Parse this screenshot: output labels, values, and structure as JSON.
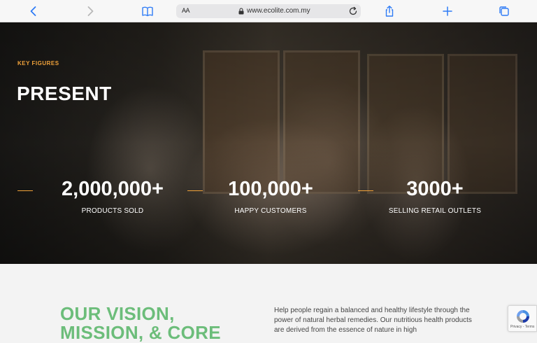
{
  "browser": {
    "text_size_label": "AA",
    "url": "www.ecolite.com.my"
  },
  "hero": {
    "kicker": "KEY FIGURES",
    "headline": "PRESENT",
    "stats": [
      {
        "value": "2,000,000+",
        "label": "PRODUCTS SOLD"
      },
      {
        "value": "100,000+",
        "label": "HAPPY CUSTOMERS"
      },
      {
        "value": "3000+",
        "label": "SELLING RETAIL OUTLETS"
      }
    ]
  },
  "vision": {
    "heading_line1": "OUR VISION,",
    "heading_line2": "MISSION, & CORE",
    "text": "Help people regain a balanced and healthy lifestyle through the power of natural herbal remedies. Our nutritious health products are derived from the essence of nature in high"
  },
  "recaptcha": {
    "links": "Privacy - Terms"
  },
  "colors": {
    "accent": "#f0a23a",
    "green": "#6cbd7a",
    "browser_blue": "#2f7cf6"
  }
}
